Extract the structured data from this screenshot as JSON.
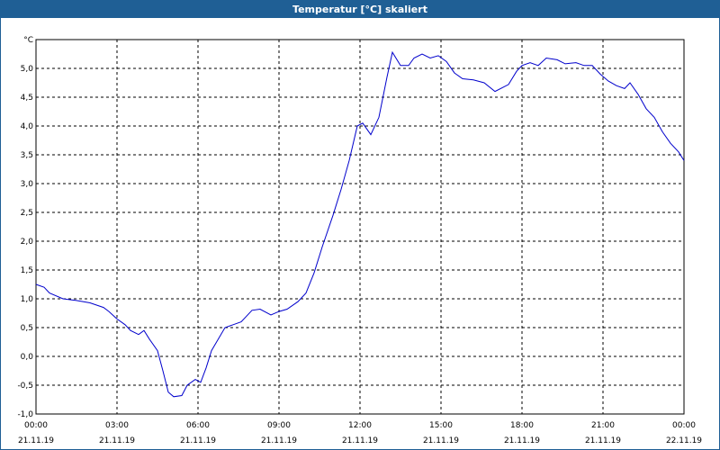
{
  "window": {
    "title": "Temperatur [°C] skaliert",
    "title_bg": "#1f5f95",
    "title_color": "#ffffff"
  },
  "chart_data": {
    "type": "line",
    "title": "Temperatur [°C] skaliert",
    "ylabel": "°C",
    "xlabel": "",
    "xlim": [
      0,
      24
    ],
    "ylim": [
      -1.0,
      5.5
    ],
    "grid": true,
    "grid_style": "dashed",
    "line_color": "#0000cc",
    "y_ticks": [
      "5,0",
      "4,5",
      "4,0",
      "3,5",
      "3,0",
      "2,5",
      "2,0",
      "1,5",
      "1,0",
      "0,5",
      "0,0",
      "-0,5",
      "-1,0"
    ],
    "x_ticks": [
      {
        "time": "00:00",
        "date": "21.11.19"
      },
      {
        "time": "03:00",
        "date": "21.11.19"
      },
      {
        "time": "06:00",
        "date": "21.11.19"
      },
      {
        "time": "09:00",
        "date": "21.11.19"
      },
      {
        "time": "12:00",
        "date": "21.11.19"
      },
      {
        "time": "15:00",
        "date": "21.11.19"
      },
      {
        "time": "18:00",
        "date": "21.11.19"
      },
      {
        "time": "21:00",
        "date": "21.11.19"
      },
      {
        "time": "00:00",
        "date": "22.11.19"
      }
    ],
    "series": [
      {
        "x": [
          0.0,
          0.3,
          0.5,
          1.0,
          1.5,
          2.0,
          2.5,
          2.7,
          3.0,
          3.3,
          3.5,
          3.8,
          4.0,
          4.2,
          4.5,
          4.7,
          4.9,
          5.1,
          5.4,
          5.6,
          5.9,
          6.1,
          6.3,
          6.5,
          7.0,
          7.3,
          7.6,
          8.0,
          8.3,
          8.7,
          9.0,
          9.3,
          9.7,
          10.0,
          10.3,
          10.6,
          11.0,
          11.3,
          11.6,
          11.9,
          12.1,
          12.4,
          12.7,
          13.0,
          13.2,
          13.5,
          13.8,
          14.0,
          14.3,
          14.6,
          14.9,
          15.2,
          15.5,
          15.8,
          16.2,
          16.6,
          17.0,
          17.5,
          17.8,
          18.0,
          18.3,
          18.6,
          18.9,
          19.3,
          19.6,
          20.0,
          20.3,
          20.6,
          20.9,
          21.2,
          21.5,
          21.8,
          22.0,
          22.3,
          22.6,
          22.9,
          23.2,
          23.5,
          23.8,
          24.0
        ],
        "y": [
          1.25,
          1.2,
          1.1,
          1.0,
          0.97,
          0.93,
          0.85,
          0.78,
          0.65,
          0.55,
          0.45,
          0.38,
          0.45,
          0.3,
          0.1,
          -0.25,
          -0.62,
          -0.7,
          -0.68,
          -0.5,
          -0.4,
          -0.45,
          -0.2,
          0.1,
          0.5,
          0.55,
          0.6,
          0.8,
          0.82,
          0.72,
          0.78,
          0.82,
          0.95,
          1.1,
          1.45,
          1.9,
          2.45,
          2.9,
          3.4,
          4.0,
          4.05,
          3.85,
          4.15,
          4.85,
          5.28,
          5.05,
          5.05,
          5.18,
          5.25,
          5.18,
          5.22,
          5.12,
          4.92,
          4.82,
          4.8,
          4.75,
          4.6,
          4.72,
          4.95,
          5.05,
          5.1,
          5.05,
          5.18,
          5.15,
          5.08,
          5.1,
          5.05,
          5.05,
          4.9,
          4.78,
          4.7,
          4.65,
          4.75,
          4.55,
          4.3,
          4.15,
          3.9,
          3.7,
          3.55,
          3.4
        ]
      }
    ]
  }
}
